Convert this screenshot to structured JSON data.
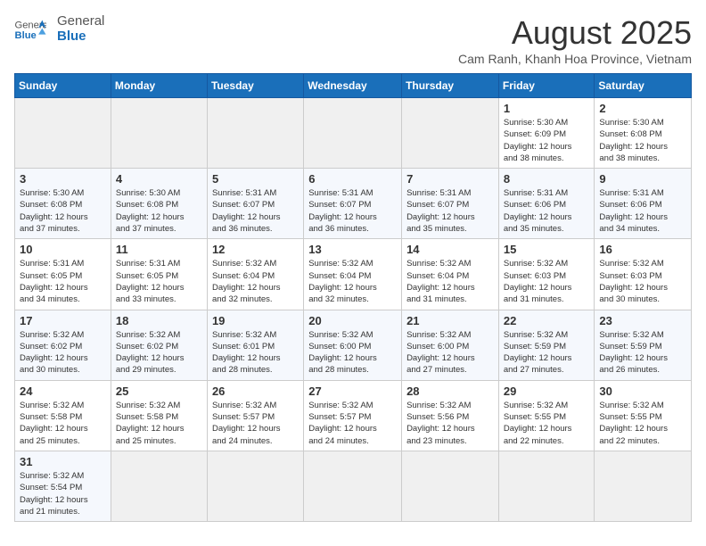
{
  "header": {
    "logo_general": "General",
    "logo_blue": "Blue",
    "month_year": "August 2025",
    "location": "Cam Ranh, Khanh Hoa Province, Vietnam"
  },
  "weekdays": [
    "Sunday",
    "Monday",
    "Tuesday",
    "Wednesday",
    "Thursday",
    "Friday",
    "Saturday"
  ],
  "weeks": [
    [
      {
        "day": "",
        "info": ""
      },
      {
        "day": "",
        "info": ""
      },
      {
        "day": "",
        "info": ""
      },
      {
        "day": "",
        "info": ""
      },
      {
        "day": "",
        "info": ""
      },
      {
        "day": "1",
        "info": "Sunrise: 5:30 AM\nSunset: 6:09 PM\nDaylight: 12 hours\nand 38 minutes."
      },
      {
        "day": "2",
        "info": "Sunrise: 5:30 AM\nSunset: 6:08 PM\nDaylight: 12 hours\nand 38 minutes."
      }
    ],
    [
      {
        "day": "3",
        "info": "Sunrise: 5:30 AM\nSunset: 6:08 PM\nDaylight: 12 hours\nand 37 minutes."
      },
      {
        "day": "4",
        "info": "Sunrise: 5:30 AM\nSunset: 6:08 PM\nDaylight: 12 hours\nand 37 minutes."
      },
      {
        "day": "5",
        "info": "Sunrise: 5:31 AM\nSunset: 6:07 PM\nDaylight: 12 hours\nand 36 minutes."
      },
      {
        "day": "6",
        "info": "Sunrise: 5:31 AM\nSunset: 6:07 PM\nDaylight: 12 hours\nand 36 minutes."
      },
      {
        "day": "7",
        "info": "Sunrise: 5:31 AM\nSunset: 6:07 PM\nDaylight: 12 hours\nand 35 minutes."
      },
      {
        "day": "8",
        "info": "Sunrise: 5:31 AM\nSunset: 6:06 PM\nDaylight: 12 hours\nand 35 minutes."
      },
      {
        "day": "9",
        "info": "Sunrise: 5:31 AM\nSunset: 6:06 PM\nDaylight: 12 hours\nand 34 minutes."
      }
    ],
    [
      {
        "day": "10",
        "info": "Sunrise: 5:31 AM\nSunset: 6:05 PM\nDaylight: 12 hours\nand 34 minutes."
      },
      {
        "day": "11",
        "info": "Sunrise: 5:31 AM\nSunset: 6:05 PM\nDaylight: 12 hours\nand 33 minutes."
      },
      {
        "day": "12",
        "info": "Sunrise: 5:32 AM\nSunset: 6:04 PM\nDaylight: 12 hours\nand 32 minutes."
      },
      {
        "day": "13",
        "info": "Sunrise: 5:32 AM\nSunset: 6:04 PM\nDaylight: 12 hours\nand 32 minutes."
      },
      {
        "day": "14",
        "info": "Sunrise: 5:32 AM\nSunset: 6:04 PM\nDaylight: 12 hours\nand 31 minutes."
      },
      {
        "day": "15",
        "info": "Sunrise: 5:32 AM\nSunset: 6:03 PM\nDaylight: 12 hours\nand 31 minutes."
      },
      {
        "day": "16",
        "info": "Sunrise: 5:32 AM\nSunset: 6:03 PM\nDaylight: 12 hours\nand 30 minutes."
      }
    ],
    [
      {
        "day": "17",
        "info": "Sunrise: 5:32 AM\nSunset: 6:02 PM\nDaylight: 12 hours\nand 30 minutes."
      },
      {
        "day": "18",
        "info": "Sunrise: 5:32 AM\nSunset: 6:02 PM\nDaylight: 12 hours\nand 29 minutes."
      },
      {
        "day": "19",
        "info": "Sunrise: 5:32 AM\nSunset: 6:01 PM\nDaylight: 12 hours\nand 28 minutes."
      },
      {
        "day": "20",
        "info": "Sunrise: 5:32 AM\nSunset: 6:00 PM\nDaylight: 12 hours\nand 28 minutes."
      },
      {
        "day": "21",
        "info": "Sunrise: 5:32 AM\nSunset: 6:00 PM\nDaylight: 12 hours\nand 27 minutes."
      },
      {
        "day": "22",
        "info": "Sunrise: 5:32 AM\nSunset: 5:59 PM\nDaylight: 12 hours\nand 27 minutes."
      },
      {
        "day": "23",
        "info": "Sunrise: 5:32 AM\nSunset: 5:59 PM\nDaylight: 12 hours\nand 26 minutes."
      }
    ],
    [
      {
        "day": "24",
        "info": "Sunrise: 5:32 AM\nSunset: 5:58 PM\nDaylight: 12 hours\nand 25 minutes."
      },
      {
        "day": "25",
        "info": "Sunrise: 5:32 AM\nSunset: 5:58 PM\nDaylight: 12 hours\nand 25 minutes."
      },
      {
        "day": "26",
        "info": "Sunrise: 5:32 AM\nSunset: 5:57 PM\nDaylight: 12 hours\nand 24 minutes."
      },
      {
        "day": "27",
        "info": "Sunrise: 5:32 AM\nSunset: 5:57 PM\nDaylight: 12 hours\nand 24 minutes."
      },
      {
        "day": "28",
        "info": "Sunrise: 5:32 AM\nSunset: 5:56 PM\nDaylight: 12 hours\nand 23 minutes."
      },
      {
        "day": "29",
        "info": "Sunrise: 5:32 AM\nSunset: 5:55 PM\nDaylight: 12 hours\nand 22 minutes."
      },
      {
        "day": "30",
        "info": "Sunrise: 5:32 AM\nSunset: 5:55 PM\nDaylight: 12 hours\nand 22 minutes."
      }
    ],
    [
      {
        "day": "31",
        "info": "Sunrise: 5:32 AM\nSunset: 5:54 PM\nDaylight: 12 hours\nand 21 minutes."
      },
      {
        "day": "",
        "info": ""
      },
      {
        "day": "",
        "info": ""
      },
      {
        "day": "",
        "info": ""
      },
      {
        "day": "",
        "info": ""
      },
      {
        "day": "",
        "info": ""
      },
      {
        "day": "",
        "info": ""
      }
    ]
  ]
}
